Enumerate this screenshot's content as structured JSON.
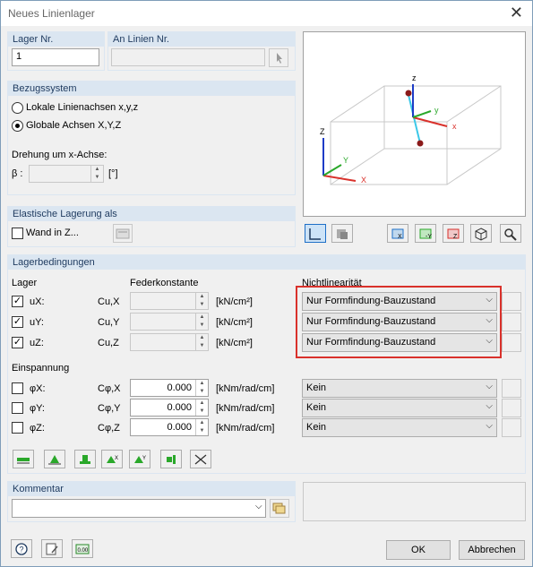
{
  "window": {
    "title": "Neues Linienlager",
    "close_label": "✕"
  },
  "lager_nr": {
    "label": "Lager Nr.",
    "value": "1"
  },
  "an_linien": {
    "label": "An Linien Nr.",
    "value": ""
  },
  "bezugssystem": {
    "label": "Bezugssystem",
    "options": [
      "Lokale Linienachsen x,y,z",
      "Globale Achsen X,Y,Z"
    ],
    "selected": 1,
    "drehung_label": "Drehung um x-Achse:",
    "beta_label": "β :",
    "beta_unit": "[°]"
  },
  "elastische": {
    "label": "Elastische Lagerung als",
    "wand_label": "Wand in Z..."
  },
  "lagerbedingungen": {
    "label": "Lagerbedingungen",
    "col_lager": "Lager",
    "col_feder": "Federkonstante",
    "col_nonlin": "Nichtlinearität",
    "rows": [
      {
        "name": "uX:",
        "c": "Cu,X",
        "unit": "[kN/cm²]",
        "value": "",
        "nonlin": "Nur Formfindung-Bauzustand",
        "checked": "✓"
      },
      {
        "name": "uY:",
        "c": "Cu,Y",
        "unit": "[kN/cm²]",
        "value": "",
        "nonlin": "Nur Formfindung-Bauzustand",
        "checked": "✓"
      },
      {
        "name": "uZ:",
        "c": "Cu,Z",
        "unit": "[kN/cm²]",
        "value": "",
        "nonlin": "Nur Formfindung-Bauzustand",
        "checked": "✓"
      }
    ],
    "einspannung_label": "Einspannung",
    "rot_rows": [
      {
        "name": "φX:",
        "c": "Cφ,X",
        "unit": "[kNm/rad/cm]",
        "value": "0.000",
        "nonlin": "Kein",
        "checked": ""
      },
      {
        "name": "φY:",
        "c": "Cφ,Y",
        "unit": "[kNm/rad/cm]",
        "value": "0.000",
        "nonlin": "Kein",
        "checked": ""
      },
      {
        "name": "φZ:",
        "c": "Cφ,Z",
        "unit": "[kNm/rad/cm]",
        "value": "0.000",
        "nonlin": "Kein",
        "checked": ""
      }
    ]
  },
  "kommentar": {
    "label": "Kommentar",
    "value": ""
  },
  "buttons": {
    "ok": "OK",
    "cancel": "Abbrechen"
  },
  "preview": {
    "axis_x": "X",
    "axis_y": "Y",
    "axis_z": "Z",
    "local_x": "x",
    "local_y": "y",
    "local_z": "z"
  },
  "colors": {
    "header_bg": "#dbe6f1",
    "highlight_red": "#d9312b",
    "accent_blue": "#1e6fc7"
  }
}
